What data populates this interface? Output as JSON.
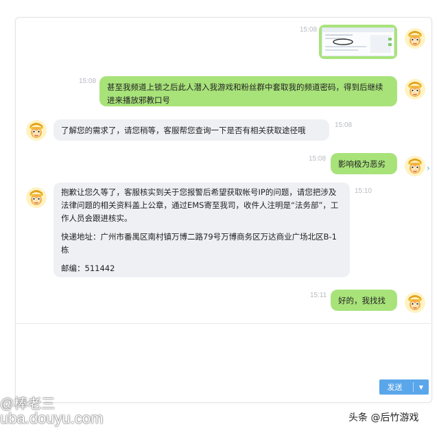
{
  "messages": [
    {
      "dir": "out",
      "time": "15:08",
      "type": "image"
    },
    {
      "dir": "out",
      "time": "15:08",
      "text": "甚至我频道上锁之后此人潜入我游戏和粉丝群中套取我的频道密码，得到后继续进来播放邪教口号"
    },
    {
      "dir": "in",
      "time": "15:08",
      "text": "了解您的需求了，请您稍等，客服帮您查询一下是否有相关获取途径哦"
    },
    {
      "dir": "out",
      "time": "15:08",
      "text": "影响极为恶劣"
    },
    {
      "dir": "in",
      "time": "15:10",
      "paragraphs": [
        "抱歉让您久等了，客服核实到关于您报警后希望获取帐号IP的问题，请您把涉及法律问题的相关资料盖上公章，通过EMS寄至我司，收件人注明是“法务部”，工作人员会跟进核实。",
        "快递地址：广州市番禺区南村镇万博二路79号万博商务区万达商业广场北区B-1栋",
        "邮编：511442"
      ]
    },
    {
      "dir": "out",
      "time": "15:11",
      "text": "好的，我找找"
    }
  ],
  "icons": {
    "user_avatar": "monkey-king-avatar-icon",
    "agent_avatar": "monkey-king-avatar-icon",
    "side_arrow": "chevron-right-icon"
  },
  "send": {
    "label": "发送",
    "dropdown_icon": "▼"
  },
  "watermarks": {
    "left_name": "@棒老三",
    "left_url": "uba.douyu.com",
    "right": "头条 @后竹游戏"
  },
  "colors": {
    "out_bubble": "#a8e37a",
    "in_bubble": "#eef0f4",
    "send_button": "#5aa6ea"
  }
}
